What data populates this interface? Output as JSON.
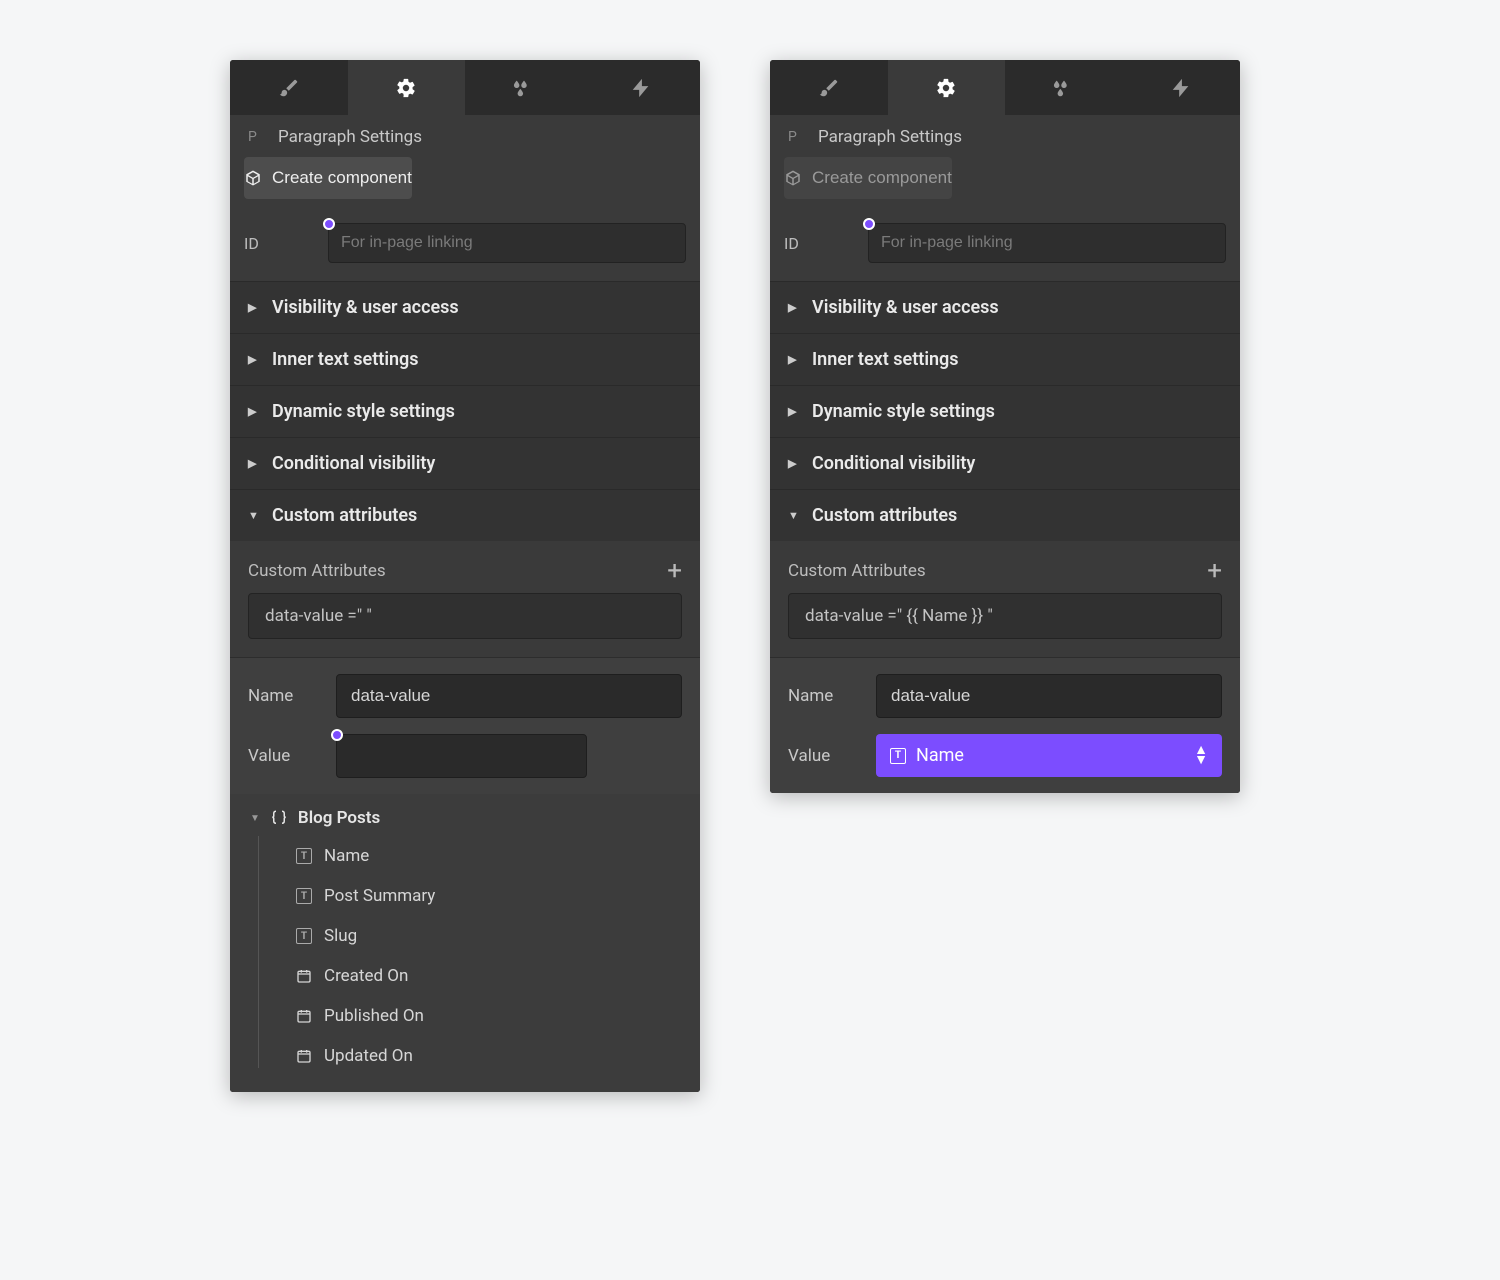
{
  "left": {
    "header": {
      "title": "Paragraph Settings"
    },
    "create_label": "Create component",
    "id_label": "ID",
    "id_placeholder": "For in-page linking",
    "sections": {
      "visibility": "Visibility & user access",
      "inner_text": "Inner text settings",
      "dynamic_style": "Dynamic style settings",
      "conditional": "Conditional visibility",
      "custom_attrs": "Custom attributes"
    },
    "custom_attrs_heading": "Custom Attributes",
    "attr_display": "data-value =\" \"",
    "name_label": "Name",
    "name_value": "data-value",
    "value_label": "Value",
    "dropdown": {
      "root": "Blog Posts",
      "items": [
        {
          "label": "Name",
          "type": "text"
        },
        {
          "label": "Post Summary",
          "type": "text"
        },
        {
          "label": "Slug",
          "type": "text"
        },
        {
          "label": "Created On",
          "type": "date"
        },
        {
          "label": "Published On",
          "type": "date"
        },
        {
          "label": "Updated On",
          "type": "date"
        }
      ]
    }
  },
  "right": {
    "header": {
      "title": "Paragraph Settings"
    },
    "create_label": "Create component",
    "id_label": "ID",
    "id_placeholder": "For in-page linking",
    "sections": {
      "visibility": "Visibility & user access",
      "inner_text": "Inner text settings",
      "dynamic_style": "Dynamic style settings",
      "conditional": "Conditional visibility",
      "custom_attrs": "Custom attributes"
    },
    "custom_attrs_heading": "Custom Attributes",
    "attr_display": "data-value =\" {{ Name }} \"",
    "name_label": "Name",
    "name_value": "data-value",
    "value_label": "Value",
    "value_selected": "Name"
  },
  "colors": {
    "accent": "#7c4dff"
  }
}
